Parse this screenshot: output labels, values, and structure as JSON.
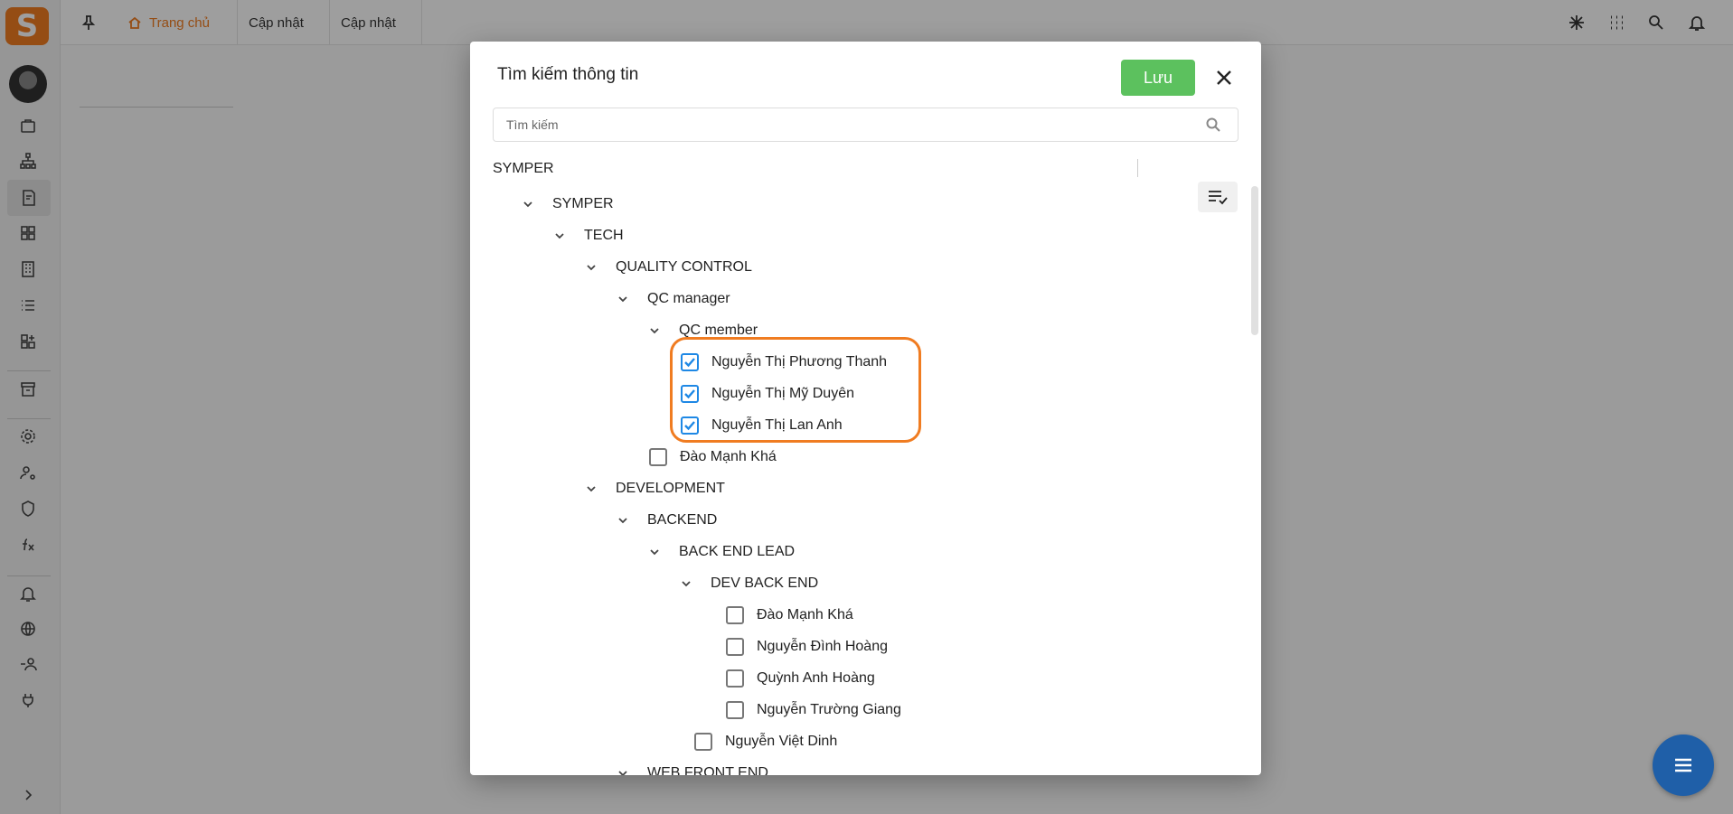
{
  "app": {
    "logo_letter": "S",
    "tabs": [
      {
        "label": "Trang chủ"
      },
      {
        "label": "Cập nhật"
      },
      {
        "label": "Cập nhật"
      }
    ],
    "accent_color": "#f07c21"
  },
  "dialog": {
    "title": "Tìm kiếm thông tin",
    "save_label": "Lưu",
    "save_color": "#5cc15e",
    "search_placeholder": "Tìm kiếm",
    "root_label": "SYMPER",
    "tree": [
      {
        "label": "SYMPER",
        "type": "group"
      },
      {
        "label": "TECH",
        "type": "group"
      },
      {
        "label": "QUALITY CONTROL",
        "type": "group"
      },
      {
        "label": "QC manager",
        "type": "group"
      },
      {
        "label": "QC member",
        "type": "group"
      },
      {
        "label": "Nguyễn Thị Phương Thanh",
        "type": "user",
        "checked": true
      },
      {
        "label": "Nguyễn Thị Mỹ Duyên",
        "type": "user",
        "checked": true
      },
      {
        "label": "Nguyễn Thị Lan Anh",
        "type": "user",
        "checked": true
      },
      {
        "label": "Đào Mạnh Khá",
        "type": "user",
        "checked": false
      },
      {
        "label": "DEVELOPMENT",
        "type": "group"
      },
      {
        "label": "BACKEND",
        "type": "group"
      },
      {
        "label": "BACK END LEAD",
        "type": "group"
      },
      {
        "label": "DEV BACK END",
        "type": "group"
      },
      {
        "label": "Đào Mạnh Khá",
        "type": "user",
        "checked": false
      },
      {
        "label": "Nguyễn Đình Hoàng",
        "type": "user",
        "checked": false
      },
      {
        "label": "Quỳnh Anh Hoàng",
        "type": "user",
        "checked": false
      },
      {
        "label": "Nguyễn Trường Giang",
        "type": "user",
        "checked": false
      },
      {
        "label": "Nguyễn Việt Dinh",
        "type": "user",
        "checked": false
      },
      {
        "label": "WEB FRONT END",
        "type": "group"
      }
    ]
  }
}
